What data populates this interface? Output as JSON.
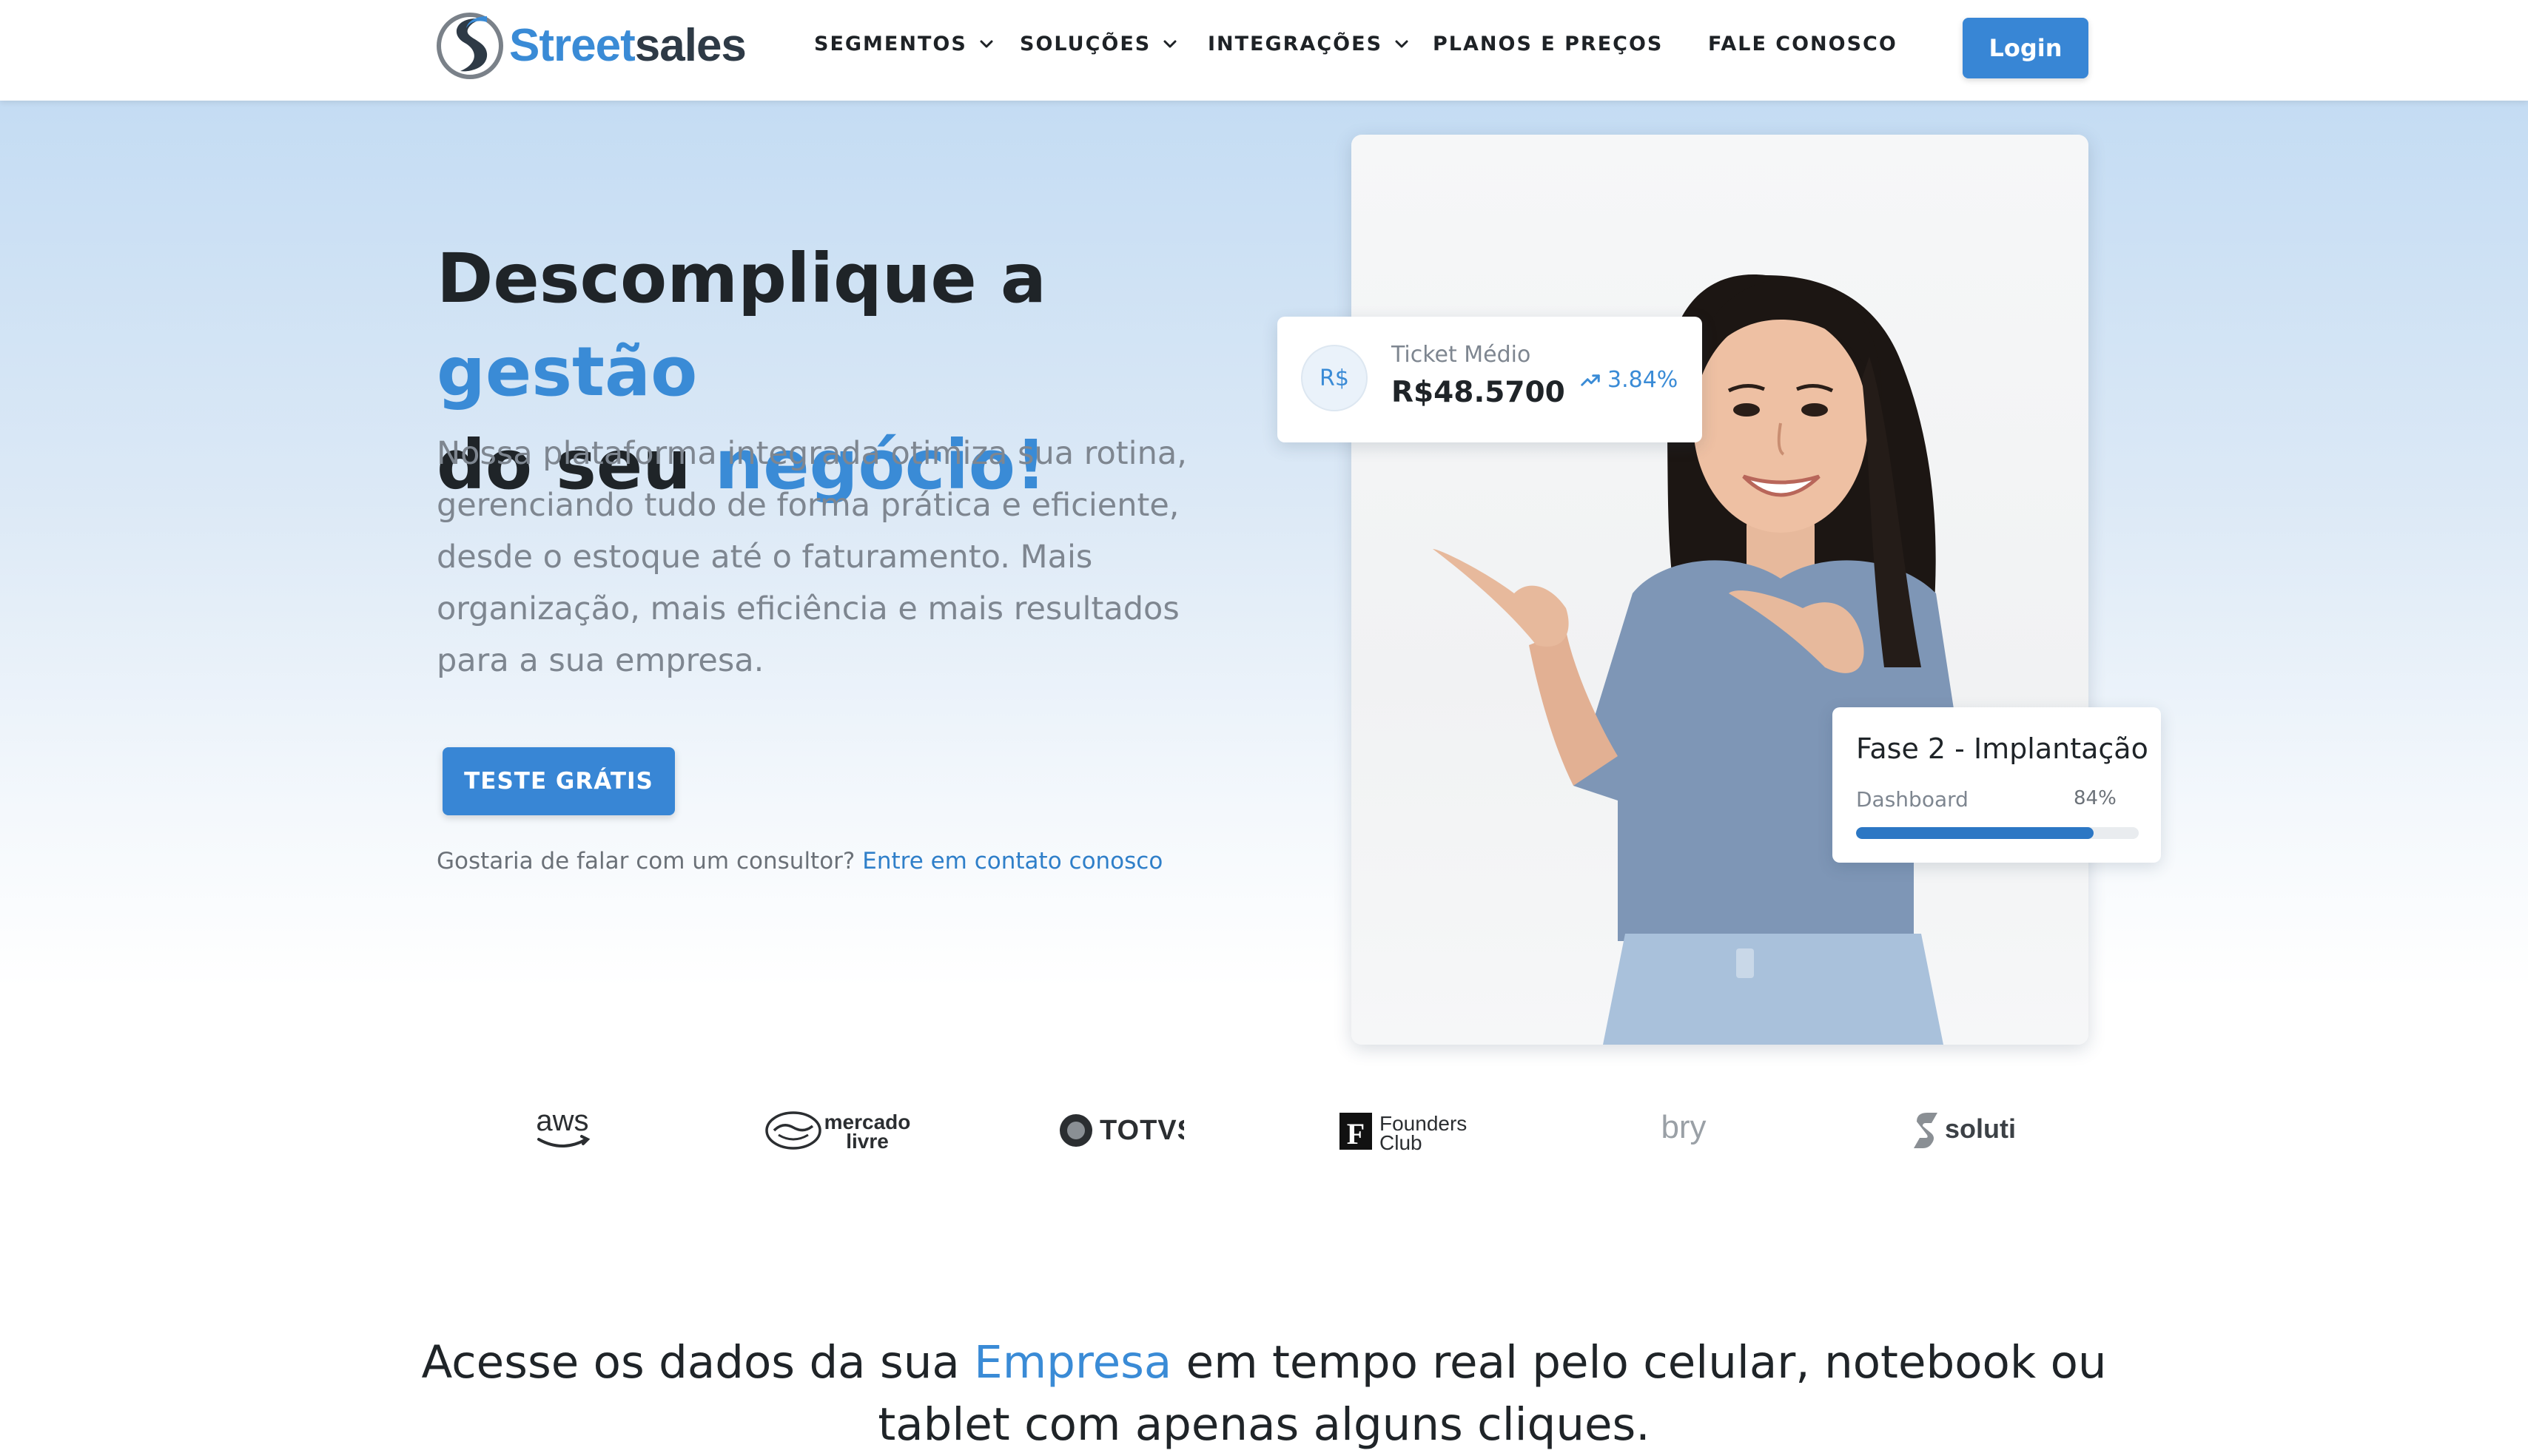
{
  "nav": {
    "logo": {
      "word1": "Street",
      "word2": "sales"
    },
    "items": [
      {
        "label": "SEGMENTOS",
        "has_dropdown": true
      },
      {
        "label": "SOLUÇÕES",
        "has_dropdown": true
      },
      {
        "label": "INTEGRAÇÕES",
        "has_dropdown": true
      },
      {
        "label": "PLANOS E PREÇOS",
        "has_dropdown": false
      },
      {
        "label": "FALE CONOSCO",
        "has_dropdown": false
      }
    ],
    "login_label": "Login"
  },
  "hero": {
    "headline": {
      "part1": "Descomplique a ",
      "part2": "gestão",
      "part3": "do seu ",
      "part4": "negócio!"
    },
    "subtext": "Nossa plataforma integrada otimiza sua rotina, gerenciando tudo de forma prática e eficiente, desde o estoque até o faturamento. Mais organização, mais eficiência e mais resultados para a sua empresa.",
    "cta_label": "TESTE GRÁTIS",
    "contact_prompt": "Gostaria de falar com um consultor?",
    "contact_link": "Entre em contato conosco"
  },
  "ticket_card": {
    "badge": "R$",
    "label": "Ticket Médio",
    "value": "R$48.5700",
    "trend": "3.84%",
    "trend_icon": "trending-up-icon"
  },
  "phase_card": {
    "title": "Fase 2 - Implantação",
    "subtitle": "Dashboard",
    "percent_text": "84%",
    "progress": 0.84
  },
  "partners": {
    "aws": "aws",
    "mercado_livre": {
      "line1": "mercado",
      "line2": "livre"
    },
    "totvs": "TOTVS",
    "founders_club": {
      "mark": "F",
      "line1": "Founders",
      "line2": "Club"
    },
    "bry": "bry",
    "soluti": "soluti"
  },
  "section": {
    "heading_part1": "Acesse os dados da sua ",
    "heading_highlight": "Empresa",
    "heading_part2": " em tempo real pelo celular, notebook ou tablet com apenas alguns cliques."
  },
  "colors": {
    "accent": "#3a8bd6",
    "button": "#3886d5",
    "progress_fill": "#2c77c4"
  }
}
